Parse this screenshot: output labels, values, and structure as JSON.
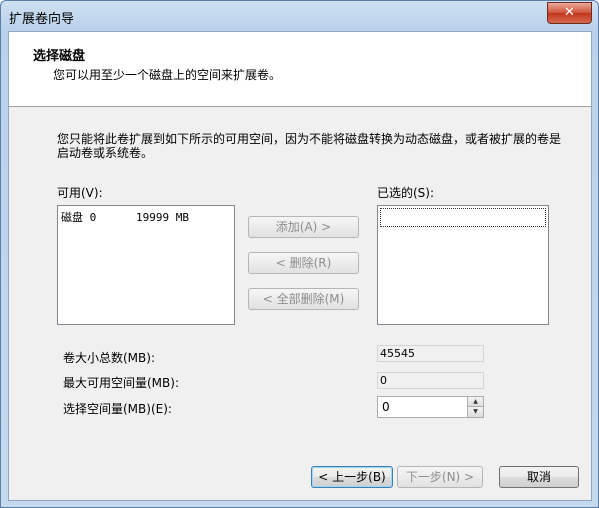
{
  "window": {
    "title": "扩展卷向导",
    "close_glyph": "✕"
  },
  "header": {
    "title": "选择磁盘",
    "subtitle": "您可以用至少一个磁盘上的空间来扩展卷。"
  },
  "description": "您只能将此卷扩展到如下所示的可用空间，因为不能将磁盘转换为动态磁盘，或者被扩展的卷是启动卷或系统卷。",
  "available": {
    "label": "可用(V):",
    "items": [
      {
        "disk": "磁盘 0",
        "size": "19999 MB"
      }
    ]
  },
  "selected": {
    "label": "已选的(S):",
    "items": []
  },
  "buttons": {
    "add": "添加(A) >",
    "remove": "< 删除(R)",
    "remove_all": "< 全部删除(M)",
    "back": "< 上一步(B)",
    "next": "下一步(N) >",
    "cancel": "取消"
  },
  "fields": {
    "total_label": "卷大小总数(MB):",
    "total_value": "45545",
    "max_label": "最大可用空间量(MB):",
    "max_value": "0",
    "select_label": "选择空间量(MB)(E):",
    "select_value": "0"
  },
  "icons": {
    "spin_up": "▲",
    "spin_down": "▼"
  }
}
